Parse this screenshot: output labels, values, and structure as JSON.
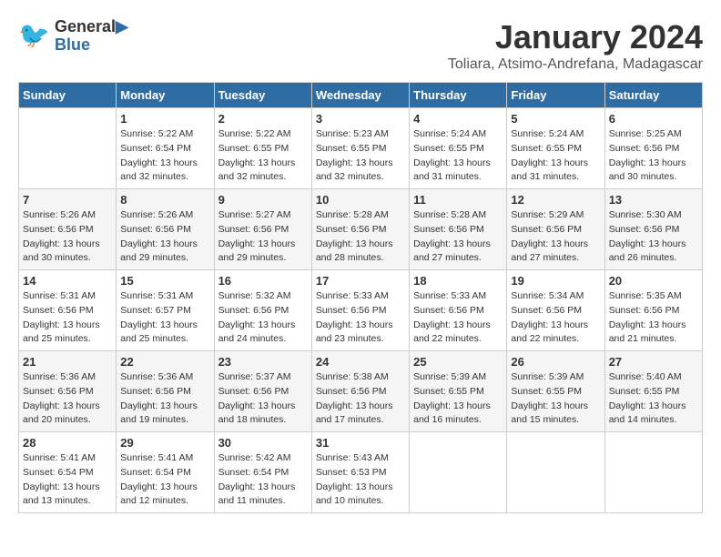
{
  "header": {
    "logo_line1": "General",
    "logo_line2": "Blue",
    "title": "January 2024",
    "subtitle": "Toliara, Atsimo-Andrefana, Madagascar"
  },
  "columns": [
    "Sunday",
    "Monday",
    "Tuesday",
    "Wednesday",
    "Thursday",
    "Friday",
    "Saturday"
  ],
  "weeks": [
    [
      {
        "day": "",
        "info": ""
      },
      {
        "day": "1",
        "info": "Sunrise: 5:22 AM\nSunset: 6:54 PM\nDaylight: 13 hours\nand 32 minutes."
      },
      {
        "day": "2",
        "info": "Sunrise: 5:22 AM\nSunset: 6:55 PM\nDaylight: 13 hours\nand 32 minutes."
      },
      {
        "day": "3",
        "info": "Sunrise: 5:23 AM\nSunset: 6:55 PM\nDaylight: 13 hours\nand 32 minutes."
      },
      {
        "day": "4",
        "info": "Sunrise: 5:24 AM\nSunset: 6:55 PM\nDaylight: 13 hours\nand 31 minutes."
      },
      {
        "day": "5",
        "info": "Sunrise: 5:24 AM\nSunset: 6:55 PM\nDaylight: 13 hours\nand 31 minutes."
      },
      {
        "day": "6",
        "info": "Sunrise: 5:25 AM\nSunset: 6:56 PM\nDaylight: 13 hours\nand 30 minutes."
      }
    ],
    [
      {
        "day": "7",
        "info": "Sunrise: 5:26 AM\nSunset: 6:56 PM\nDaylight: 13 hours\nand 30 minutes."
      },
      {
        "day": "8",
        "info": "Sunrise: 5:26 AM\nSunset: 6:56 PM\nDaylight: 13 hours\nand 29 minutes."
      },
      {
        "day": "9",
        "info": "Sunrise: 5:27 AM\nSunset: 6:56 PM\nDaylight: 13 hours\nand 29 minutes."
      },
      {
        "day": "10",
        "info": "Sunrise: 5:28 AM\nSunset: 6:56 PM\nDaylight: 13 hours\nand 28 minutes."
      },
      {
        "day": "11",
        "info": "Sunrise: 5:28 AM\nSunset: 6:56 PM\nDaylight: 13 hours\nand 27 minutes."
      },
      {
        "day": "12",
        "info": "Sunrise: 5:29 AM\nSunset: 6:56 PM\nDaylight: 13 hours\nand 27 minutes."
      },
      {
        "day": "13",
        "info": "Sunrise: 5:30 AM\nSunset: 6:56 PM\nDaylight: 13 hours\nand 26 minutes."
      }
    ],
    [
      {
        "day": "14",
        "info": "Sunrise: 5:31 AM\nSunset: 6:56 PM\nDaylight: 13 hours\nand 25 minutes."
      },
      {
        "day": "15",
        "info": "Sunrise: 5:31 AM\nSunset: 6:57 PM\nDaylight: 13 hours\nand 25 minutes."
      },
      {
        "day": "16",
        "info": "Sunrise: 5:32 AM\nSunset: 6:56 PM\nDaylight: 13 hours\nand 24 minutes."
      },
      {
        "day": "17",
        "info": "Sunrise: 5:33 AM\nSunset: 6:56 PM\nDaylight: 13 hours\nand 23 minutes."
      },
      {
        "day": "18",
        "info": "Sunrise: 5:33 AM\nSunset: 6:56 PM\nDaylight: 13 hours\nand 22 minutes."
      },
      {
        "day": "19",
        "info": "Sunrise: 5:34 AM\nSunset: 6:56 PM\nDaylight: 13 hours\nand 22 minutes."
      },
      {
        "day": "20",
        "info": "Sunrise: 5:35 AM\nSunset: 6:56 PM\nDaylight: 13 hours\nand 21 minutes."
      }
    ],
    [
      {
        "day": "21",
        "info": "Sunrise: 5:36 AM\nSunset: 6:56 PM\nDaylight: 13 hours\nand 20 minutes."
      },
      {
        "day": "22",
        "info": "Sunrise: 5:36 AM\nSunset: 6:56 PM\nDaylight: 13 hours\nand 19 minutes."
      },
      {
        "day": "23",
        "info": "Sunrise: 5:37 AM\nSunset: 6:56 PM\nDaylight: 13 hours\nand 18 minutes."
      },
      {
        "day": "24",
        "info": "Sunrise: 5:38 AM\nSunset: 6:56 PM\nDaylight: 13 hours\nand 17 minutes."
      },
      {
        "day": "25",
        "info": "Sunrise: 5:39 AM\nSunset: 6:55 PM\nDaylight: 13 hours\nand 16 minutes."
      },
      {
        "day": "26",
        "info": "Sunrise: 5:39 AM\nSunset: 6:55 PM\nDaylight: 13 hours\nand 15 minutes."
      },
      {
        "day": "27",
        "info": "Sunrise: 5:40 AM\nSunset: 6:55 PM\nDaylight: 13 hours\nand 14 minutes."
      }
    ],
    [
      {
        "day": "28",
        "info": "Sunrise: 5:41 AM\nSunset: 6:54 PM\nDaylight: 13 hours\nand 13 minutes."
      },
      {
        "day": "29",
        "info": "Sunrise: 5:41 AM\nSunset: 6:54 PM\nDaylight: 13 hours\nand 12 minutes."
      },
      {
        "day": "30",
        "info": "Sunrise: 5:42 AM\nSunset: 6:54 PM\nDaylight: 13 hours\nand 11 minutes."
      },
      {
        "day": "31",
        "info": "Sunrise: 5:43 AM\nSunset: 6:53 PM\nDaylight: 13 hours\nand 10 minutes."
      },
      {
        "day": "",
        "info": ""
      },
      {
        "day": "",
        "info": ""
      },
      {
        "day": "",
        "info": ""
      }
    ]
  ]
}
